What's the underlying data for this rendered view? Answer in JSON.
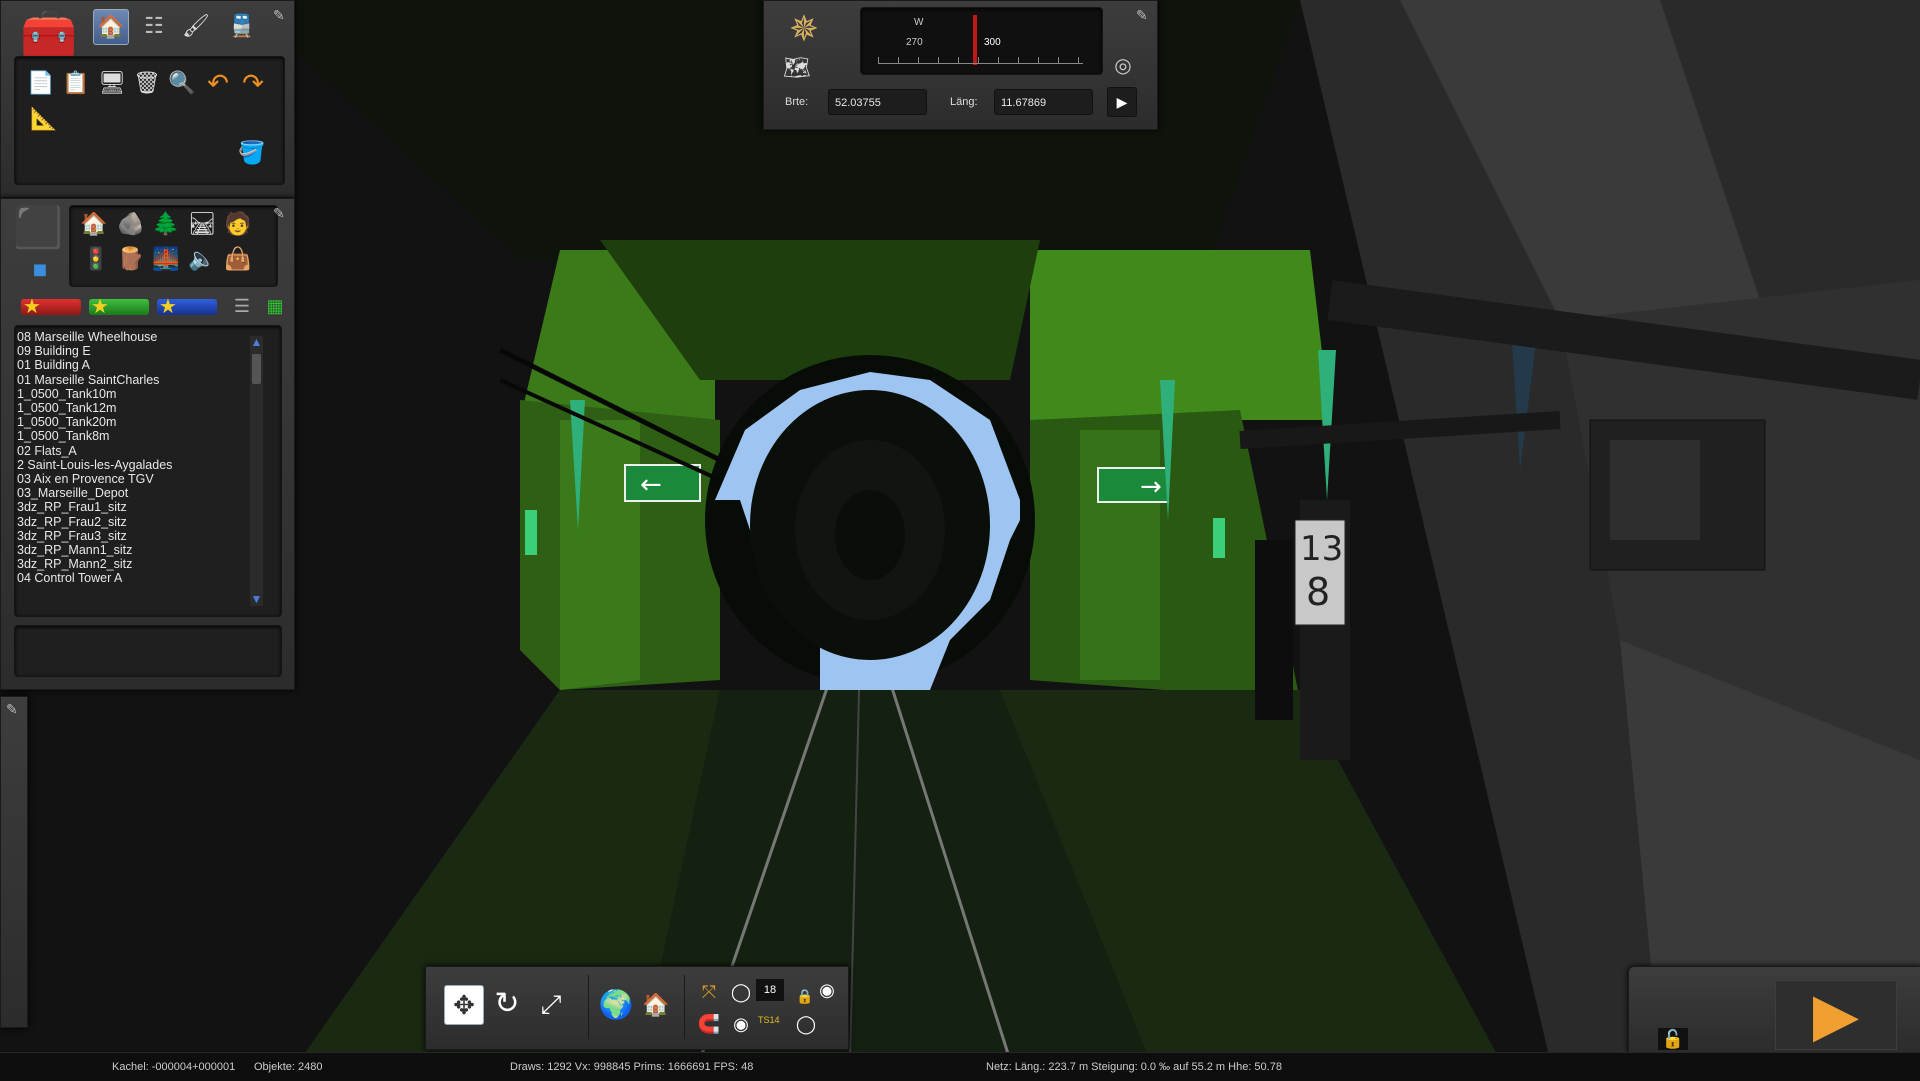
{
  "toolbox": {
    "icons": [
      "toolbox-icon",
      "home-icon",
      "track-icon",
      "brush-icon",
      "train-icon"
    ],
    "tools": [
      "copy-icon",
      "paste-icon",
      "monitor-icon",
      "trash-icon",
      "zoom-icon",
      "undo-icon",
      "redo-icon",
      "ruler-icon"
    ]
  },
  "objects_panel": {
    "categories": [
      "cube-icon",
      "house-icon",
      "rock-icon",
      "tree-icon",
      "track-pieces-icon",
      "person-icon",
      "signal-icon",
      "wood-icon",
      "bridge-icon",
      "speaker-icon",
      "bag-icon"
    ],
    "favorites": [
      "favorite-red",
      "favorite-green",
      "favorite-blue"
    ],
    "assets": [
      "08 Marseille Wheelhouse",
      "09 Building E",
      "01 Building A",
      "01 Marseille SaintCharles",
      "1_0500_Tank10m",
      "1_0500_Tank12m",
      "1_0500_Tank20m",
      "1_0500_Tank8m",
      "02 Flats_A",
      "2 Saint-Louis-les-Aygalades",
      "03 Aix en Provence TGV",
      "03_Marseille_Depot",
      "3dz_RP_Frau1_sitz",
      "3dz_RP_Frau2_sitz",
      "3dz_RP_Frau3_sitz",
      "3dz_RP_Mann1_sitz",
      "3dz_RP_Mann2_sitz",
      "04 Control Tower A"
    ]
  },
  "compass": {
    "heading_letter": "W",
    "ticks": [
      "270",
      "300"
    ],
    "lat_label": "Brte:",
    "lat_value": "52.03755",
    "lon_label": "Läng:",
    "lon_value": "11.67869"
  },
  "scene": {
    "sign_top": "13",
    "sign_bottom": "8"
  },
  "bottom_toolbar": {
    "counter": "18",
    "tag": "TS14"
  },
  "status": {
    "tile": "Kachel: -000004+000001",
    "objects": "Objekte: 2480",
    "draws": "Draws: 1292 Vx: 998845 Prims: 1666691 FPS: 48",
    "network": "Netz:  Läng.:  223.7 m Steigung:  0.0 ‰ auf 55.2 m Hhe:  50.78"
  },
  "colors": {
    "accent_blue": "#4a7fe0",
    "tunnel_green": "#3f8a1a",
    "play_orange": "#f0a030",
    "toolbox_red": "#c8242a"
  }
}
